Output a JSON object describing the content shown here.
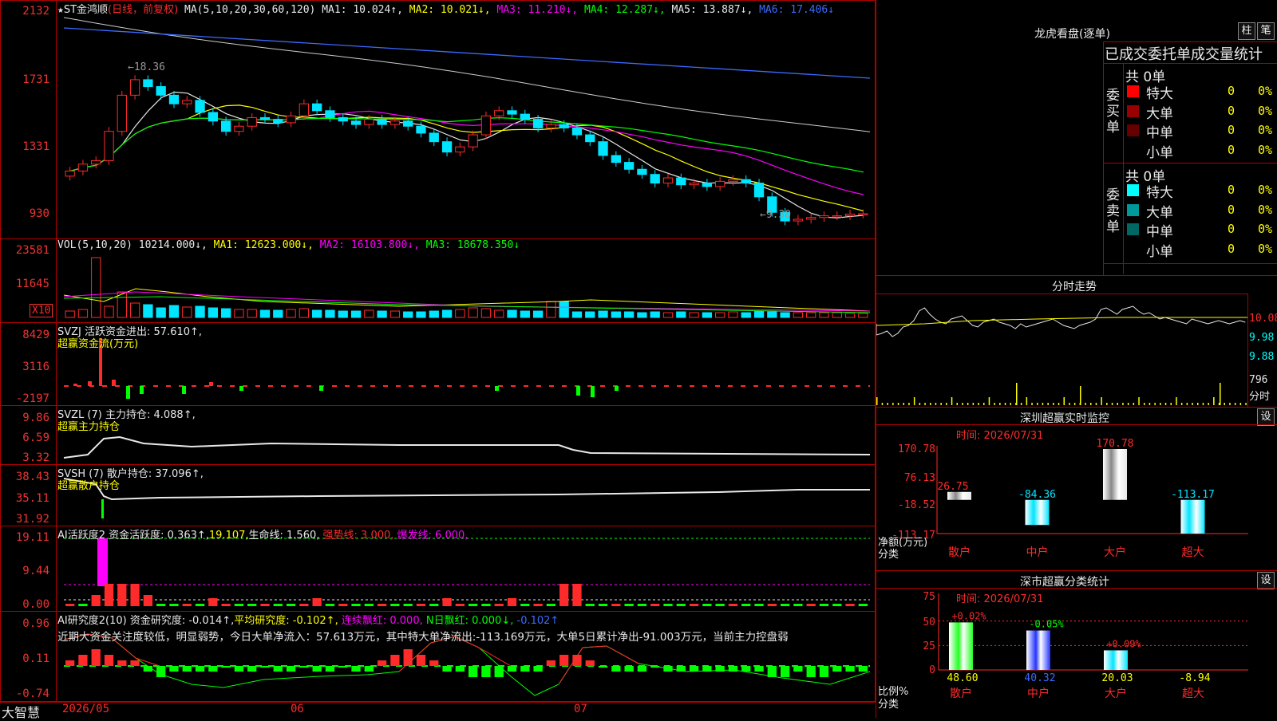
{
  "price_pane": {
    "title_star": "★",
    "title": "ST金鸿顺",
    "title_suffix": "(日线，前复权)",
    "ma_label": "MA(5,10,20,30,60,120)",
    "ma1": "MA1: 10.024↑,",
    "ma2": "MA2: 10.021↓,",
    "ma3": "MA3: 11.210↓,",
    "ma4": "MA4: 12.287↓,",
    "ma5": "MA5: 13.887↓,",
    "ma6": "MA6: 17.406↓",
    "y_labels": [
      "2132",
      "1731",
      "1331",
      "930"
    ],
    "high_marker": "←18.36",
    "low_marker": "←9.30"
  },
  "vol_pane": {
    "label": "VOL(5,10,20)",
    "value": "10214.000↓,",
    "ma1": "MA1: 12623.000↓,",
    "ma2": "MA2: 16103.800↓,",
    "ma3": "MA3: 18678.350↓",
    "y_labels": [
      "23581",
      "11645"
    ],
    "unit": "X10"
  },
  "svzj_pane": {
    "label": "SVZJ  活跃资金进出: 57.610↑,",
    "sub": "超赢资金流(万元)",
    "y_labels": [
      "8429",
      "3116",
      "-2197"
    ]
  },
  "svzl_pane": {
    "label": "SVZL (7) 主力持仓: 4.088↑,",
    "sub": "超赢主力持仓",
    "y_labels": [
      "9.86",
      "6.59",
      "3.32"
    ]
  },
  "svsh_pane": {
    "label": "SVSH (7) 散户持仓: 37.096↑,",
    "sub": "超赢散户持仓",
    "y_labels": [
      "38.43",
      "35.11",
      "31.92"
    ]
  },
  "ai_active_pane": {
    "label": "AI活跃度2 资金活跃度: 0.363↑,",
    "v2": "19.107,",
    "life": "生命线: 1.560,",
    "strong": "强势线: 3.000,",
    "burst": "爆发线: 6.000,",
    "y_labels": [
      "19.11",
      "9.44",
      "0.00"
    ]
  },
  "ai_research_pane": {
    "label": "AI研究度2(10) 资金研究度: -0.014↑,",
    "avg": "平均研究度: -0.102↑,",
    "cont": "连续飘红: 0.000,",
    "ndays": "N日飘红: 0.000↓,",
    "last": "-0.102↑",
    "note": "近期大资金关注度较低，明显弱势，今日大单净流入：57.613万元，其中特大单净流出:-113.169万元，大单5日累计净出-91.003万元，当前主力控盘弱",
    "y_labels": [
      "0.96",
      "0.11",
      "-0.74"
    ]
  },
  "x_axis": {
    "logo": "大智慧",
    "dates": [
      "2026/05",
      "06",
      "07"
    ]
  },
  "dragon_panel": {
    "title": "龙虎看盘(逐单)",
    "btn1": "柱",
    "btn2": "笔",
    "header": "已成交委托单成交量统计",
    "buy": {
      "side": "委买单",
      "total": "共 0单",
      "rows": [
        {
          "name": "特大",
          "count": "0",
          "pct": "0%",
          "color": "#ff0000"
        },
        {
          "name": "大单",
          "count": "0",
          "pct": "0%",
          "color": "#990000"
        },
        {
          "name": "中单",
          "count": "0",
          "pct": "0%",
          "color": "#660000"
        },
        {
          "name": "小单",
          "count": "0",
          "pct": "0%",
          "color": "#000000"
        }
      ]
    },
    "sell": {
      "side": "委卖单",
      "total": "共 0单",
      "rows": [
        {
          "name": "特大",
          "count": "0",
          "pct": "0%",
          "color": "#00ffff"
        },
        {
          "name": "大单",
          "count": "0",
          "pct": "0%",
          "color": "#009999"
        },
        {
          "name": "中单",
          "count": "0",
          "pct": "0%",
          "color": "#006666"
        },
        {
          "name": "小单",
          "count": "0",
          "pct": "0%",
          "color": "#000000"
        }
      ]
    }
  },
  "intraday": {
    "title": "分时走势",
    "y_labels": [
      "10.08",
      "9.98",
      "9.88"
    ],
    "vol_label": "796",
    "vol_unit": "分时"
  },
  "sz_monitor": {
    "title": "深圳超赢实时监控",
    "btn": "设",
    "time": "时间: 2026/07/31",
    "y_labels": [
      "170.78",
      "76.13",
      "-18.52",
      "-113.17"
    ],
    "axis_title": "净额(万元)",
    "axis_sub": "分类",
    "chart_data": {
      "type": "bar",
      "categories": [
        "散户",
        "中户",
        "大户",
        "超大"
      ],
      "values": [
        26.75,
        -84.36,
        170.78,
        -113.17
      ],
      "value_labels": [
        "26.75",
        "-84.36",
        "170.78",
        "-113.17"
      ],
      "ylim": [
        -113.17,
        170.78
      ]
    }
  },
  "sz_category": {
    "title": "深市超赢分类统计",
    "btn": "设",
    "time": "时间: 2026/07/31",
    "y_labels": [
      "75",
      "50",
      "25",
      "0"
    ],
    "axis_title": "比例%",
    "axis_sub": "分类",
    "chart_data": {
      "type": "bar",
      "categories": [
        "散户",
        "中户",
        "大户",
        "超大"
      ],
      "values": [
        48.6,
        40.32,
        20.03,
        -8.94
      ],
      "value_labels": [
        "48.60",
        "40.32",
        "20.03",
        "-8.94"
      ],
      "change_labels": [
        "+0.02%",
        "-0.05%",
        "+0.09%",
        ""
      ],
      "ylim": [
        0,
        75
      ]
    }
  },
  "colors": {
    "up": "#ff2a2a",
    "down": "#00e5ff",
    "border": "#b00000"
  }
}
